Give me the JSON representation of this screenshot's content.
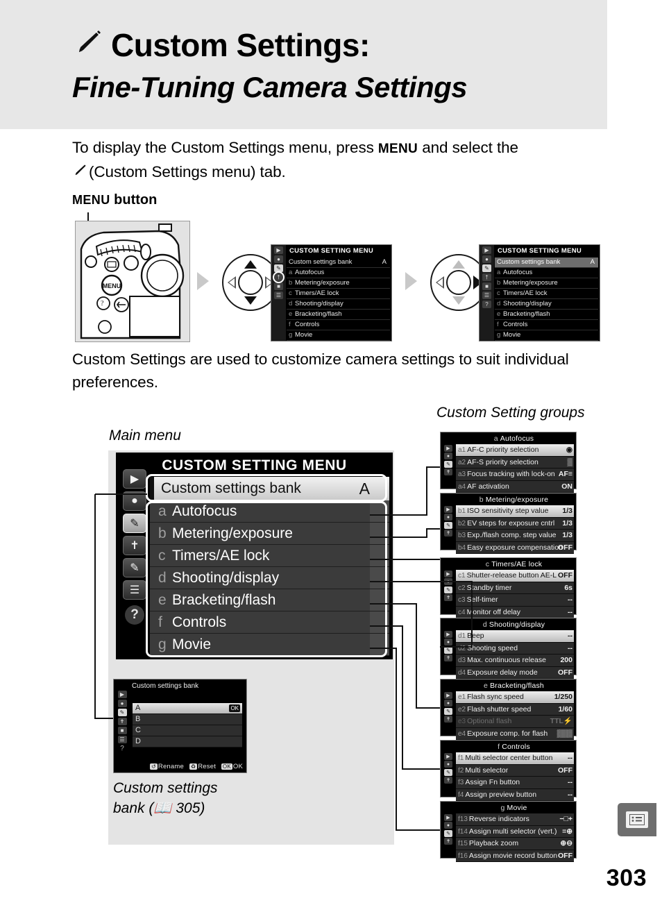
{
  "page": {
    "number": "303",
    "badge_icon": "menu-list-icon"
  },
  "header": {
    "icon": "pencil-icon",
    "title_line1": "Custom Settings:",
    "title_line2": "Fine-Tuning Camera Settings",
    "band_color": "#e7e7e7"
  },
  "intro": {
    "p1_a": "To display the Custom Settings menu, press ",
    "p1_menu": "MENU",
    "p1_b": " and select the ",
    "p1_c": "(Custom Settings menu) tab.",
    "p2": "Custom Settings are used to customize camera settings to suit individual preferences."
  },
  "flow": {
    "menu_button_label_prefix": "MENU",
    "menu_button_label_suffix": " button",
    "camera_alt": "camera-back-illustration",
    "step1_lcd": {
      "title": "CUSTOM SETTING MENU",
      "bank_label": "Custom settings bank",
      "bank_value": "A",
      "rows": [
        {
          "letter": "a",
          "label": "Autofocus"
        },
        {
          "letter": "b",
          "label": "Metering/exposure"
        },
        {
          "letter": "c",
          "label": "Timers/AE lock"
        },
        {
          "letter": "d",
          "label": "Shooting/display"
        },
        {
          "letter": "e",
          "label": "Bracketing/flash"
        },
        {
          "letter": "f",
          "label": "Controls"
        },
        {
          "letter": "g",
          "label": "Movie"
        }
      ]
    },
    "step2_lcd": {
      "title": "CUSTOM SETTING MENU",
      "bank_label": "Custom settings bank",
      "bank_value": "A",
      "rows": [
        {
          "letter": "a",
          "label": "Autofocus"
        },
        {
          "letter": "b",
          "label": "Metering/exposure"
        },
        {
          "letter": "c",
          "label": "Timers/AE lock"
        },
        {
          "letter": "d",
          "label": "Shooting/display"
        },
        {
          "letter": "e",
          "label": "Bracketing/flash"
        },
        {
          "letter": "f",
          "label": "Controls"
        },
        {
          "letter": "g",
          "label": "Movie"
        }
      ]
    }
  },
  "labels": {
    "main_menu": "Main menu",
    "custom_setting_groups": "Custom Setting groups",
    "bank_caption_line1": "Custom settings",
    "bank_caption_line2_a": "bank (",
    "bank_caption_icon": "book-icon",
    "bank_caption_line2_b": "305)"
  },
  "main_menu": {
    "title": "CUSTOM SETTING MENU",
    "bank_label": "Custom settings bank",
    "bank_value": "A",
    "sidebar_icons": [
      "playback-icon",
      "camera-icon",
      "pencil-icon",
      "wrench-icon",
      "retouch-icon",
      "my-menu-icon",
      "help-icon"
    ],
    "rows": [
      {
        "letter": "a",
        "label": "Autofocus"
      },
      {
        "letter": "b",
        "label": "Metering/exposure"
      },
      {
        "letter": "c",
        "label": "Timers/AE lock"
      },
      {
        "letter": "d",
        "label": "Shooting/display"
      },
      {
        "letter": "e",
        "label": "Bracketing/flash"
      },
      {
        "letter": "f",
        "label": "Controls"
      },
      {
        "letter": "g",
        "label": "Movie"
      }
    ]
  },
  "bank_dialog": {
    "title": "Custom settings bank",
    "rows": [
      "A",
      "B",
      "C",
      "D"
    ],
    "selected": "A",
    "ok_badge": "OK",
    "footer_rename": "Rename",
    "footer_reset": "Reset",
    "footer_ok": "OK"
  },
  "groups": [
    {
      "letter": "a",
      "title": "Autofocus",
      "rows": [
        {
          "id": "a1",
          "label": "AF-C priority selection",
          "value": "◉",
          "state": "selected"
        },
        {
          "id": "a2",
          "label": "AF-S priority selection",
          "value": "▒",
          "state": "normal"
        },
        {
          "id": "a3",
          "label": "Focus tracking with lock-on",
          "value": "AF≡",
          "state": "normal"
        },
        {
          "id": "a4",
          "label": "AF activation",
          "value": "ON",
          "state": "normal"
        }
      ]
    },
    {
      "letter": "b",
      "title": "Metering/exposure",
      "rows": [
        {
          "id": "b1",
          "label": "ISO sensitivity step value",
          "value": "1/3",
          "state": "selected"
        },
        {
          "id": "b2",
          "label": "EV steps for exposure cntrl",
          "value": "1/3",
          "state": "normal"
        },
        {
          "id": "b3",
          "label": "Exp./flash comp. step value",
          "value": "1/3",
          "state": "normal"
        },
        {
          "id": "b4",
          "label": "Easy exposure compensation",
          "value": "OFF",
          "state": "normal"
        }
      ]
    },
    {
      "letter": "c",
      "title": "Timers/AE lock",
      "rows": [
        {
          "id": "c1",
          "label": "Shutter-release button AE-L",
          "value": "OFF",
          "state": "selected"
        },
        {
          "id": "c2",
          "label": "Standby timer",
          "value": "6s",
          "state": "normal"
        },
        {
          "id": "c3",
          "label": "Self-timer",
          "value": "--",
          "state": "normal"
        },
        {
          "id": "c4",
          "label": "Monitor off delay",
          "value": "--",
          "state": "normal"
        }
      ]
    },
    {
      "letter": "d",
      "title": "Shooting/display",
      "rows": [
        {
          "id": "d1",
          "label": "Beep",
          "value": "--",
          "state": "selected"
        },
        {
          "id": "d2",
          "label": "Shooting speed",
          "value": "--",
          "state": "normal"
        },
        {
          "id": "d3",
          "label": "Max. continuous release",
          "value": "200",
          "state": "normal"
        },
        {
          "id": "d4",
          "label": "Exposure delay mode",
          "value": "OFF",
          "state": "normal"
        }
      ]
    },
    {
      "letter": "e",
      "title": "Bracketing/flash",
      "rows": [
        {
          "id": "e1",
          "label": "Flash sync speed",
          "value": "1/250",
          "state": "selected"
        },
        {
          "id": "e2",
          "label": "Flash shutter speed",
          "value": "1/60",
          "state": "normal"
        },
        {
          "id": "e3",
          "label": "Optional flash",
          "value": "TTL⚡",
          "state": "dim"
        },
        {
          "id": "e4",
          "label": "Exposure comp. for flash",
          "value": "▒▒▒",
          "state": "normal"
        }
      ]
    },
    {
      "letter": "f",
      "title": "Controls",
      "rows": [
        {
          "id": "f1",
          "label": "Multi selector center button",
          "value": "--",
          "state": "selected"
        },
        {
          "id": "f2",
          "label": "Multi selector",
          "value": "OFF",
          "state": "normal"
        },
        {
          "id": "f3",
          "label": "Assign Fn button",
          "value": "--",
          "state": "normal"
        },
        {
          "id": "f4",
          "label": "Assign preview button",
          "value": "--",
          "state": "normal"
        }
      ]
    },
    {
      "letter": "g",
      "title": "Movie",
      "rows": [
        {
          "id": "f13",
          "label": "Reverse indicators",
          "value": "−□+",
          "state": "normal"
        },
        {
          "id": "f14",
          "label": "Assign multi selector (vert.)",
          "value": "=⊕",
          "state": "normal"
        },
        {
          "id": "f15",
          "label": "Playback zoom",
          "value": "⊕⊖",
          "state": "normal"
        },
        {
          "id": "f16",
          "label": "Assign movie record button",
          "value": "OFF",
          "state": "normal"
        }
      ]
    }
  ]
}
